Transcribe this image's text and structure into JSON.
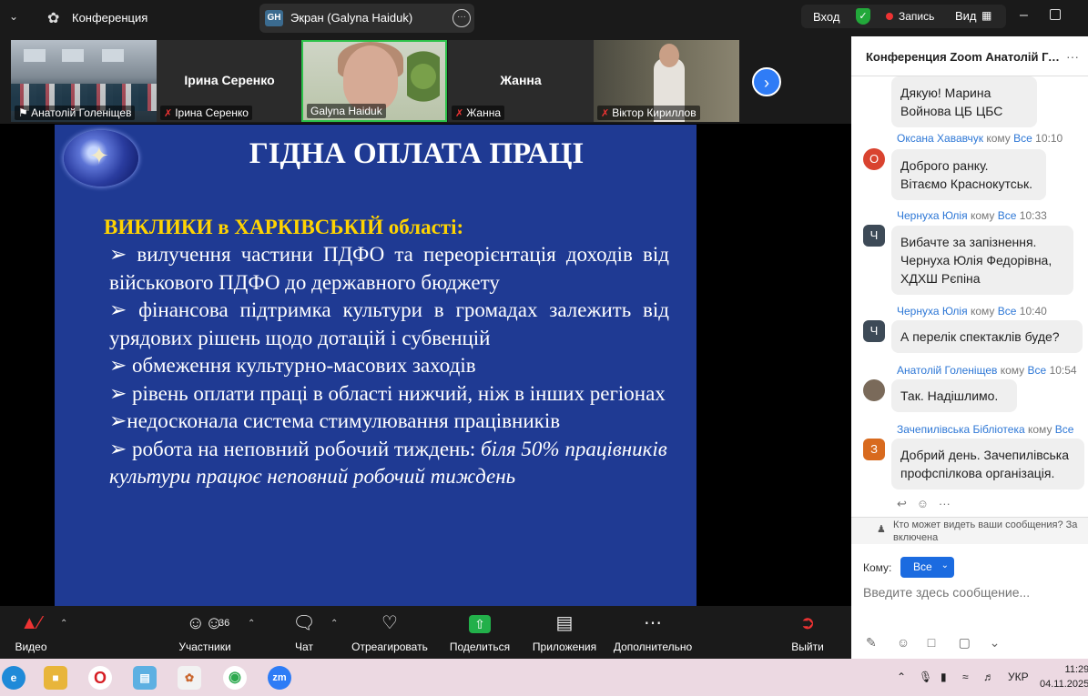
{
  "topbar": {
    "conference_label": "Конференция",
    "screen_share_badge": "GH",
    "screen_share_label": "Экран (Galyna Haiduk)",
    "enter_label": "Вход",
    "record_label": "Запись",
    "view_label": "Вид"
  },
  "participants": [
    {
      "name": "Анатолій Голеніщев",
      "muted": false
    },
    {
      "name": "Ірина Серенко",
      "muted": true
    },
    {
      "name": "Galyna Haiduk",
      "muted": false
    },
    {
      "name": "Жанна",
      "muted": true
    },
    {
      "name": "Віктор Кириллов",
      "muted": true
    }
  ],
  "slide": {
    "title": "ГІДНА ОПЛАТА ПРАЦІ",
    "subtitle_bold": "ВИКЛИКИ в ХАРКІВСЬКІЙ",
    "subtitle_rest": "області:",
    "bullets": [
      "➢  вилучення частини ПДФО та переорієнтація доходів від військового ПДФО до державного бюджету",
      "➢ фінансова підтримка культури в громадах залежить від урядових рішень щодо дотацій і субвенцій",
      "➢  обмеження культурно-масових заходів",
      "➢  рівень оплати праці в області нижчий, ніж в інших регіонах",
      "➢недосконала система стимулювання працівників"
    ],
    "last_bullet_plain": "➢  робота на неповний робочий тиждень: ",
    "last_bullet_italic": "біля 50% працівників культури працює неповний робочий тиждень"
  },
  "toolbar": {
    "video": "Видео",
    "participants": "Участники",
    "participants_count": "36",
    "chat": "Чат",
    "react": "Отреагировать",
    "share": "Поделиться",
    "apps": "Приложения",
    "more": "Дополнительно",
    "leave": "Выйти"
  },
  "chat": {
    "title": "Конференция Zoom Анатолій Голеніщев",
    "messages": [
      {
        "sender": "",
        "to": "",
        "time": "",
        "avatar": "",
        "avatar_color": "",
        "text": "Дякую!  Марина Войнова ЦБ ЦБС"
      },
      {
        "sender": "Оксана Хававчук",
        "kom": "кому",
        "to": "Все",
        "time": "10:10",
        "avatar": "О",
        "avatar_color": "#d9432f",
        "text": "Доброго ранку. Вітаємо Краснокутськ."
      },
      {
        "sender": "Чернуха Юлія",
        "kom": "кому",
        "to": "Все",
        "time": "10:33",
        "avatar": "Ч",
        "avatar_color": "#3d4a57",
        "text": "Вибачте за запізнення. Чернуха Юлія Федорівна, ХДХШ Рєпіна"
      },
      {
        "sender": "Чернуха Юлія",
        "kom": "кому",
        "to": "Все",
        "time": "10:40",
        "avatar": "Ч",
        "avatar_color": "#3d4a57",
        "text": "А перелік спектаклів буде?"
      },
      {
        "sender": "Анатолій Голеніщев",
        "kom": "кому",
        "to": "Все",
        "time": "10:54",
        "avatar": "",
        "avatar_color": "#7a6a5a",
        "text": "Так. Надішлимо."
      },
      {
        "sender": "Зачепилівська Бібліотека",
        "kom": "кому",
        "to": "Все",
        "time": "",
        "avatar": "З",
        "avatar_color": "#d86a1e",
        "text": "Добрий день. Зачепилівська профспілкова організація."
      }
    ],
    "privacy_text": "Кто может видеть ваши сообщения? За включена",
    "to_label": "Кому:",
    "to_value": "Все",
    "input_placeholder": "Введите здесь сообщение..."
  },
  "taskbar": {
    "lang": "УКР",
    "time": "11:29",
    "date": "04.11.2025"
  }
}
